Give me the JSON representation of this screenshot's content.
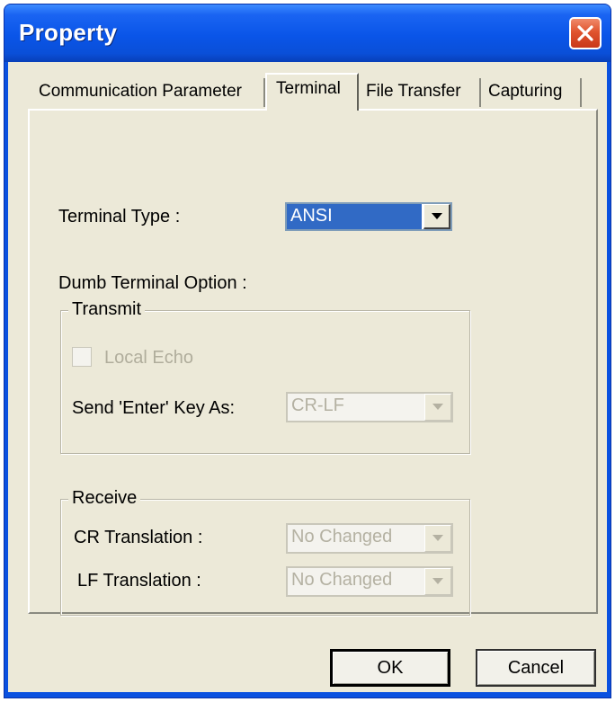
{
  "window": {
    "title": "Property"
  },
  "tabs": [
    {
      "label": "Communication Parameter",
      "active": false
    },
    {
      "label": "Terminal",
      "active": true
    },
    {
      "label": "File Transfer",
      "active": false
    },
    {
      "label": "Capturing",
      "active": false
    }
  ],
  "terminal": {
    "type_label": "Terminal Type :",
    "type_value": "ANSI",
    "dumb_option_label": "Dumb Terminal Option :",
    "transmit": {
      "legend": "Transmit",
      "local_echo_label": "Local Echo",
      "local_echo_checked": false,
      "send_enter_label": "Send 'Enter' Key  As:",
      "send_enter_value": "CR-LF"
    },
    "receive": {
      "legend": "Receive",
      "cr_label": "CR Translation :",
      "cr_value": "No Changed",
      "lf_label": "LF Translation :",
      "lf_value": "No Changed"
    }
  },
  "buttons": {
    "ok": "OK",
    "cancel": "Cancel"
  },
  "colors": {
    "titlebar": "#0a55e8",
    "dialog_face": "#ece9d8",
    "close_button": "#e0542f",
    "selection": "#316ac5",
    "disabled_text": "#b0ad9c"
  },
  "icons": {
    "close": "close-icon",
    "dropdown": "chevron-down-icon"
  }
}
